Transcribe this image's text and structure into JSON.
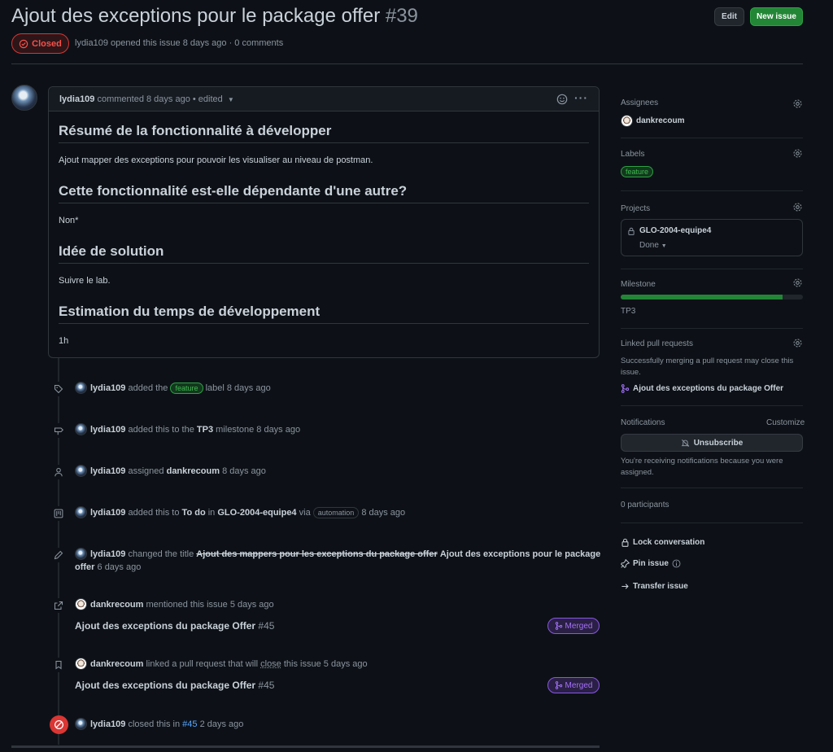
{
  "header": {
    "title": "Ajout des exceptions pour le package offer",
    "number": "#39",
    "edit_label": "Edit",
    "new_issue_label": "New issue",
    "status": "Closed",
    "author": "lydia109",
    "opened_text": "opened this issue 8 days ago · 0 comments"
  },
  "comment": {
    "author": "lydia109",
    "meta": "commented 8 days ago • edited",
    "sections": [
      {
        "heading": "Résumé de la fonctionnalité à développer",
        "body": "Ajout mapper des exceptions pour pouvoir les visualiser au niveau de postman."
      },
      {
        "heading": "Cette fonctionnalité est-elle dépendante d'une autre?",
        "body": "Non*"
      },
      {
        "heading": "Idée de solution",
        "body": "Suivre le lab."
      },
      {
        "heading": "Estimation du temps de développement",
        "body": "1h"
      }
    ]
  },
  "timeline": {
    "e1": {
      "actor": "lydia109",
      "pre": "added the",
      "label": "feature",
      "post": "label 8 days ago"
    },
    "e2": {
      "actor": "lydia109",
      "pre": "added this to the",
      "milestone": "TP3",
      "post": "milestone 8 days ago"
    },
    "e3": {
      "actor": "lydia109",
      "pre": "assigned",
      "user": "dankrecoum",
      "post": "8 days ago"
    },
    "e4": {
      "actor": "lydia109",
      "pre": "added this to",
      "col": "To do",
      "in": "in",
      "project": "GLO-2004-equipe4",
      "via": "via",
      "tag": "automation",
      "post": "8 days ago"
    },
    "e5": {
      "actor": "lydia109",
      "pre": "changed the title",
      "old": "Ajout des mappers pour les exceptions du package offer",
      "new1": "Ajout des exceptions pour le package",
      "new2": "offer",
      "post": "6 days ago"
    },
    "e6": {
      "actor": "dankrecoum",
      "pre": "mentioned this issue 5 days ago",
      "pr_title": "Ajout des exceptions du package Offer",
      "pr_num": "#45",
      "badge": "Merged"
    },
    "e7": {
      "actor": "dankrecoum",
      "pre": "linked a pull request that will",
      "close": "close",
      "post": "this issue 5 days ago",
      "pr_title": "Ajout des exceptions du package Offer",
      "pr_num": "#45",
      "badge": "Merged"
    },
    "e8": {
      "actor": "lydia109",
      "pre": "closed this in",
      "ref": "#45",
      "post": "2 days ago"
    }
  },
  "sidebar": {
    "assignees_label": "Assignees",
    "assignee": "dankrecoum",
    "labels_label": "Labels",
    "label": "feature",
    "projects_label": "Projects",
    "project": "GLO-2004-equipe4",
    "project_status": "Done",
    "milestone_label": "Milestone",
    "milestone": "TP3",
    "milestone_progress": 0.89,
    "linked_label": "Linked pull requests",
    "linked_desc1": "Successfully merging a pull request may close this",
    "linked_desc2": "issue.",
    "linked_pr": "Ajout des exceptions du package Offer",
    "notifications_label": "Notifications",
    "customize": "Customize",
    "unsubscribe": "Unsubscribe",
    "notif_desc1": "You're receiving notifications because you were",
    "notif_desc2": "assigned.",
    "participants": "0 participants",
    "lock": "Lock conversation",
    "pin": "Pin issue",
    "transfer": "Transfer issue"
  },
  "colors": {
    "accent": "#58a6ff",
    "closed": "#f85149",
    "merged": "#a371f7",
    "green": "#238636"
  }
}
